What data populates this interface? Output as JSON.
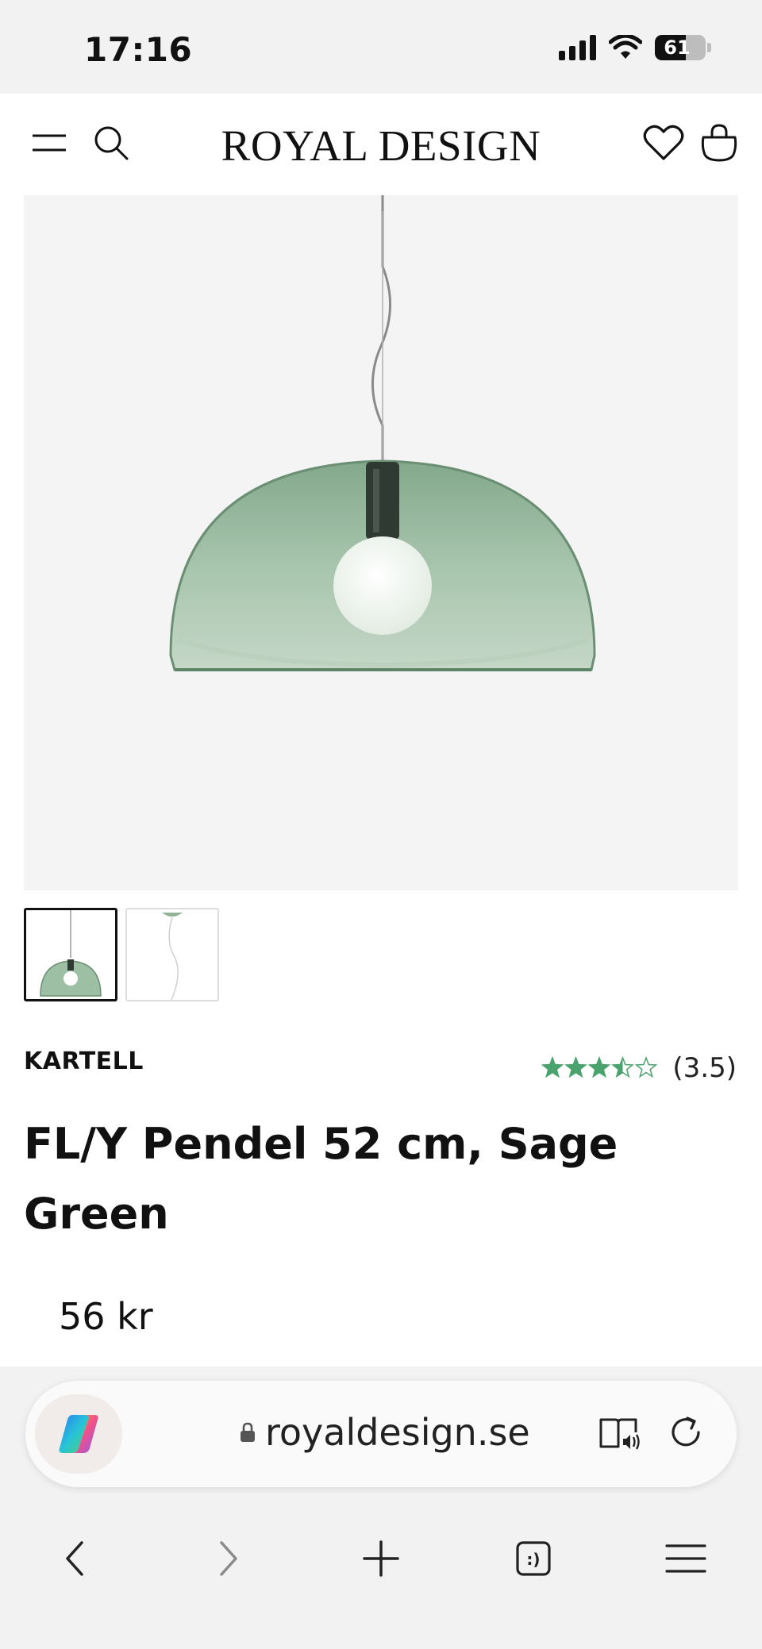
{
  "status_bar": {
    "time": "17:16",
    "battery": "61",
    "battery_level": 0.61
  },
  "header": {
    "logo": "ROYAL DESIGN"
  },
  "product": {
    "brand": "KARTELL",
    "title": "FL/Y Pendel 52 cm, Sage Green",
    "price": "56 kr",
    "rating": 3.5,
    "rating_text": "(3.5)",
    "star_color": "#4aa36c"
  },
  "gallery": {
    "thumbnail_count": 2,
    "active_index": 0
  },
  "colors": {
    "accent_green": "#4aa36c",
    "lamp_green": "#8fb394"
  },
  "browser": {
    "url": "royaldesign.se"
  },
  "icons": {
    "header": [
      "menu-icon",
      "search-icon",
      "heart-icon",
      "bag-icon"
    ],
    "floating": [
      "cookie-icon",
      "chat-icon"
    ],
    "browser": [
      "copilot-icon",
      "lock-icon",
      "reader-icon",
      "reload-icon",
      "back-icon",
      "forward-icon",
      "new-tab-icon",
      "tabs-icon",
      "browser-menu-icon"
    ]
  }
}
